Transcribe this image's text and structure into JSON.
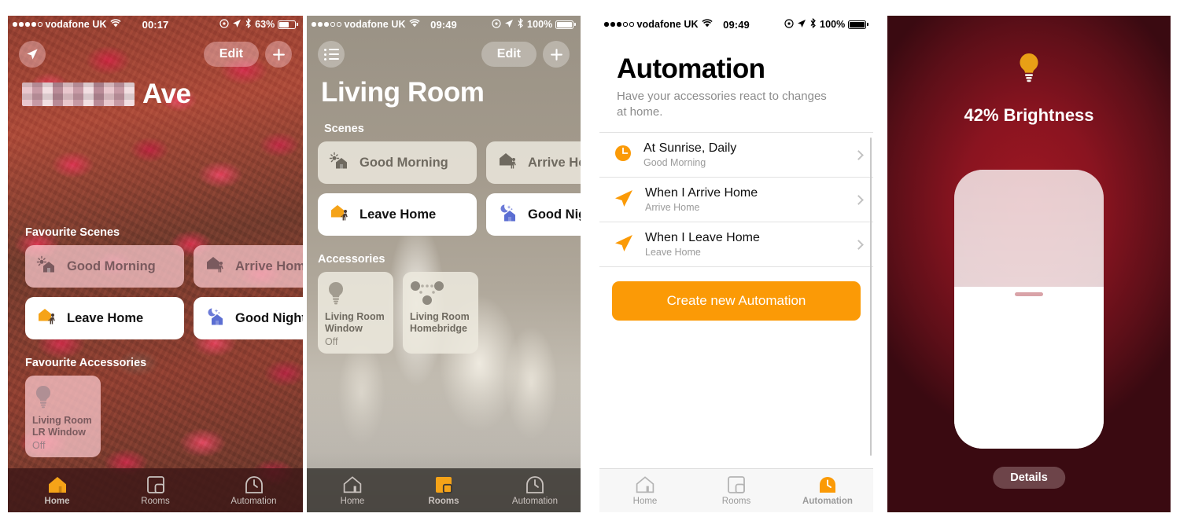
{
  "panels": {
    "home": {
      "status": {
        "carrier": "vodafone UK",
        "time": "00:17",
        "battery": "63%",
        "signal_dots": 4,
        "battery_pct": 63
      },
      "nav": {
        "location_icon": "location-arrow-icon",
        "edit_label": "Edit",
        "add_label": "+"
      },
      "title_suffix": "Ave",
      "sections": {
        "scenes_label": "Favourite Scenes",
        "accessories_label": "Favourite Accessories"
      },
      "scenes": [
        {
          "label": "Good Morning",
          "icon": "sun-house-icon",
          "state": "off"
        },
        {
          "label": "Arrive Home",
          "icon": "house-person-icon",
          "state": "off"
        },
        {
          "label": "Leave Home",
          "icon": "house-person-orange-icon",
          "state": "on"
        },
        {
          "label": "Good Night",
          "icon": "moon-house-icon",
          "state": "on"
        }
      ],
      "accessories": [
        {
          "room": "Living Room",
          "name": "LR Window",
          "status": "Off",
          "icon": "bulb-icon"
        }
      ],
      "tabs": [
        {
          "label": "Home",
          "icon": "house-icon",
          "active": true
        },
        {
          "label": "Rooms",
          "icon": "rooms-icon",
          "active": false
        },
        {
          "label": "Automation",
          "icon": "clock-icon",
          "active": false
        }
      ]
    },
    "room": {
      "status": {
        "carrier": "vodafone UK",
        "time": "09:49",
        "battery": "100%",
        "signal_dots": 3,
        "battery_pct": 100
      },
      "nav": {
        "list_icon": "list-icon",
        "edit_label": "Edit",
        "add_label": "+"
      },
      "title": "Living Room",
      "sections": {
        "scenes_label": "Scenes",
        "accessories_label": "Accessories"
      },
      "scenes": [
        {
          "label": "Good Morning",
          "icon": "sun-house-icon",
          "state": "off"
        },
        {
          "label": "Arrive Home",
          "icon": "house-person-icon",
          "state": "off"
        },
        {
          "label": "Leave Home",
          "icon": "house-person-orange-icon",
          "state": "on"
        },
        {
          "label": "Good Night",
          "icon": "moon-house-icon",
          "state": "on"
        }
      ],
      "accessories": [
        {
          "room": "Living Room",
          "name": "Window",
          "status": "Off",
          "icon": "bulb-icon"
        },
        {
          "room": "Living Room",
          "name": "Homebridge",
          "status": "",
          "icon": "bridge-icon"
        }
      ],
      "tabs": [
        {
          "label": "Home",
          "icon": "house-icon",
          "active": false
        },
        {
          "label": "Rooms",
          "icon": "rooms-icon",
          "active": true
        },
        {
          "label": "Automation",
          "icon": "clock-icon",
          "active": false
        }
      ]
    },
    "automation": {
      "status": {
        "carrier": "vodafone UK",
        "time": "09:49",
        "battery": "100%",
        "signal_dots": 3,
        "battery_pct": 100
      },
      "heading": "Automation",
      "subheading": "Have your accessories react to changes at home.",
      "rows": [
        {
          "title": "At Sunrise, Daily",
          "subtitle": "Good Morning",
          "icon": "clock-filled-icon"
        },
        {
          "title": "When I Arrive Home",
          "subtitle": "Arrive Home",
          "icon": "location-arrow-icon"
        },
        {
          "title": "When I Leave Home",
          "subtitle": "Leave Home",
          "icon": "location-arrow-icon"
        }
      ],
      "cta_label": "Create new Automation",
      "tabs": [
        {
          "label": "Home",
          "icon": "house-icon",
          "active": false
        },
        {
          "label": "Rooms",
          "icon": "rooms-icon",
          "active": false
        },
        {
          "label": "Automation",
          "icon": "clock-icon",
          "active": true
        }
      ]
    },
    "brightness": {
      "label": "42% Brightness",
      "value_pct": 42,
      "icon": "bulb-icon",
      "details_label": "Details"
    }
  },
  "colors": {
    "accent_orange": "#F5A318",
    "cta_orange": "#FB9A06",
    "bulb_orange": "#E8A016",
    "scene_on_bg": "#FFFFFF",
    "red_bg": "#8A1420"
  }
}
